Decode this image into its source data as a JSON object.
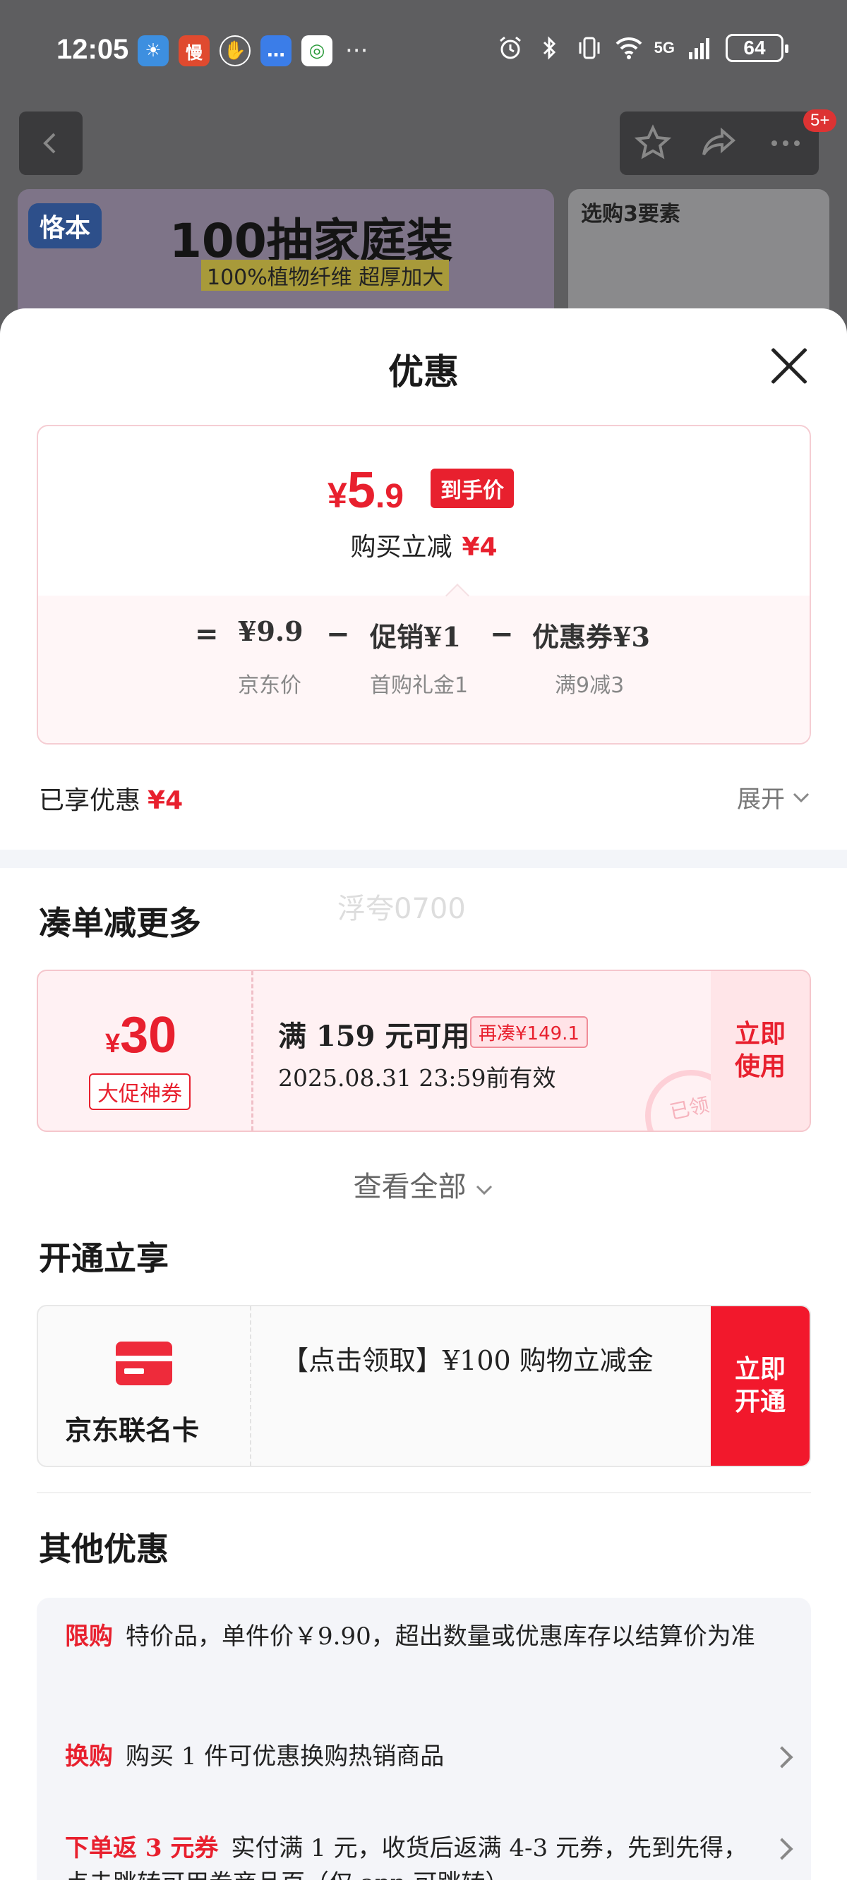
{
  "status_bar": {
    "time": "12:05",
    "app_icons": [
      "weather-icon",
      "man-icon",
      "hand-icon",
      "message-icon",
      "mobile-icon"
    ],
    "more": "···",
    "network": "5G",
    "battery": "64"
  },
  "background": {
    "banner_brand": "恪本",
    "banner_title": "100抽家庭装",
    "banner_subtitle": "100%植物纤维 超厚加大",
    "banner_right_title": "选购3要素",
    "nav_badge": "5+"
  },
  "sheet": {
    "title": "优惠",
    "price": {
      "currency": "¥",
      "integer": "5",
      "decimal": ".9",
      "tag": "到手价",
      "reduce_label": "购买立减",
      "reduce_value": "¥4",
      "equals": "=",
      "minus": "−",
      "items": [
        {
          "label": "¥9.9",
          "sub": "京东价"
        },
        {
          "label": "促销¥1",
          "sub": "首购礼金1"
        },
        {
          "label": "优惠券¥3",
          "sub": "满9减3"
        }
      ]
    },
    "enjoyed": {
      "label": "已享优惠",
      "value": "¥4"
    },
    "expand_label": "展开",
    "watermark": "浮夸0700",
    "more_section": {
      "title": "凑单减更多",
      "coupon": {
        "currency": "¥",
        "amount": "30",
        "tag": "大促神券",
        "condition": "满 159 元可用",
        "badge": "再凑¥149.1",
        "expiry": "2025.08.31 23:59前有效",
        "button": "立即使用",
        "stamp": "已领"
      },
      "view_all": "查看全部"
    },
    "open_section": {
      "title": "开通立享",
      "card_name": "京东联名卡",
      "card_desc": "【点击领取】¥100 购物立减金",
      "button": "立即开通"
    },
    "other_section": {
      "title": "其他优惠",
      "rows": [
        {
          "label": "限购",
          "text": "特价品，单件价￥9.90，超出数量或优惠库存以结算价为准"
        },
        {
          "label": "换购",
          "text": "购买 1 件可优惠换购热销商品"
        },
        {
          "label": "下单返 3 元券",
          "text": "实付满 1 元，收货后返满 4-3 元券，先到先得，点击跳转可用券商品页（仅 app 可跳转）"
        }
      ]
    }
  }
}
